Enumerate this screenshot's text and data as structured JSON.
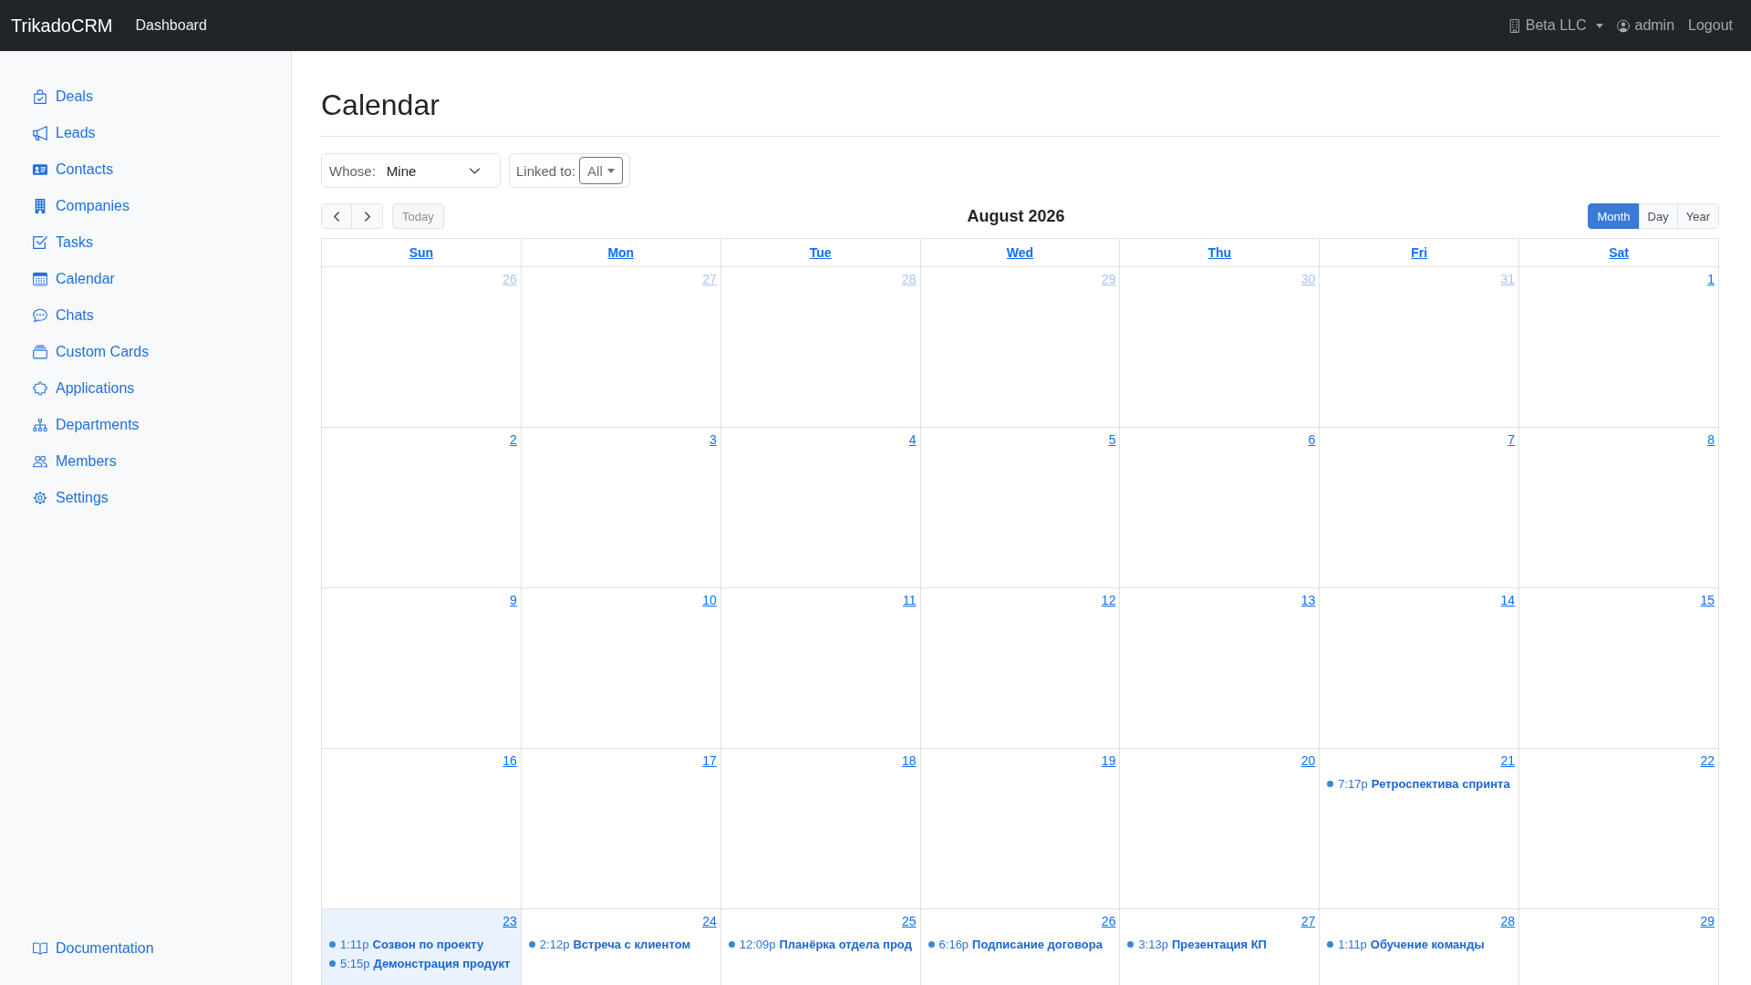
{
  "navbar": {
    "brand": "TrikadoCRM",
    "links": [
      {
        "label": "Dashboard"
      }
    ],
    "company": "Beta LLC",
    "user": "admin",
    "logout": "Logout"
  },
  "sidebar": {
    "items": [
      "Deals",
      "Leads",
      "Contacts",
      "Companies",
      "Tasks",
      "Calendar",
      "Chats",
      "Custom Cards",
      "Applications",
      "Departments",
      "Members",
      "Settings"
    ],
    "footer": [
      "Documentation"
    ]
  },
  "page": {
    "title": "Calendar"
  },
  "filters": {
    "whose": {
      "label": "Whose:",
      "value": "Mine"
    },
    "linked_to": {
      "label": "Linked to:",
      "value": "All"
    }
  },
  "calendar": {
    "title": "August 2026",
    "today_button": {
      "label": "Today",
      "disabled": true
    },
    "views": [
      {
        "label": "Month",
        "selected": true
      },
      {
        "label": "Day",
        "selected": false
      },
      {
        "label": "Year",
        "selected": false
      }
    ],
    "weekdays": [
      "Sun",
      "Mon",
      "Tue",
      "Wed",
      "Thu",
      "Fri",
      "Sat"
    ],
    "weeks": [
      [
        {
          "day": "26",
          "other_month": true,
          "today": false
        },
        {
          "day": "27",
          "other_month": true,
          "today": false
        },
        {
          "day": "28",
          "other_month": true,
          "today": false
        },
        {
          "day": "29",
          "other_month": true,
          "today": false
        },
        {
          "day": "30",
          "other_month": true,
          "today": false
        },
        {
          "day": "31",
          "other_month": true,
          "today": false
        },
        {
          "day": "1",
          "other_month": false,
          "today": false
        }
      ],
      [
        {
          "day": "2",
          "other_month": false,
          "today": false
        },
        {
          "day": "3",
          "other_month": false,
          "today": false
        },
        {
          "day": "4",
          "other_month": false,
          "today": false
        },
        {
          "day": "5",
          "other_month": false,
          "today": false
        },
        {
          "day": "6",
          "other_month": false,
          "today": false
        },
        {
          "day": "7",
          "other_month": false,
          "today": false
        },
        {
          "day": "8",
          "other_month": false,
          "today": false
        }
      ],
      [
        {
          "day": "9",
          "other_month": false,
          "today": false
        },
        {
          "day": "10",
          "other_month": false,
          "today": false
        },
        {
          "day": "11",
          "other_month": false,
          "today": false
        },
        {
          "day": "12",
          "other_month": false,
          "today": false
        },
        {
          "day": "13",
          "other_month": false,
          "today": false
        },
        {
          "day": "14",
          "other_month": false,
          "today": false
        },
        {
          "day": "15",
          "other_month": false,
          "today": false
        }
      ],
      [
        {
          "day": "16",
          "other_month": false,
          "today": false
        },
        {
          "day": "17",
          "other_month": false,
          "today": false
        },
        {
          "day": "18",
          "other_month": false,
          "today": false
        },
        {
          "day": "19",
          "other_month": false,
          "today": false
        },
        {
          "day": "20",
          "other_month": false,
          "today": false
        },
        {
          "day": "21",
          "other_month": false,
          "today": false,
          "events": [
            {
              "time": "7:17p",
              "title": "Ретроспектива спринта"
            }
          ]
        },
        {
          "day": "22",
          "other_month": false,
          "today": false
        }
      ],
      [
        {
          "day": "23",
          "other_month": false,
          "today": true,
          "events": [
            {
              "time": "1:11p",
              "title": "Созвон по проекту"
            },
            {
              "time": "5:15p",
              "title": "Демонстрация продукт"
            }
          ]
        },
        {
          "day": "24",
          "other_month": false,
          "today": false,
          "events": [
            {
              "time": "2:12p",
              "title": "Встреча с клиентом"
            }
          ]
        },
        {
          "day": "25",
          "other_month": false,
          "today": false,
          "events": [
            {
              "time": "12:09p",
              "title": "Планёрка отдела прод"
            }
          ]
        },
        {
          "day": "26",
          "other_month": false,
          "today": false,
          "events": [
            {
              "time": "6:16p",
              "title": "Подписание договора"
            }
          ]
        },
        {
          "day": "27",
          "other_month": false,
          "today": false,
          "events": [
            {
              "time": "3:13p",
              "title": "Презентация КП"
            }
          ]
        },
        {
          "day": "28",
          "other_month": false,
          "today": false,
          "events": [
            {
              "time": "1:11p",
              "title": "Обучение команды"
            }
          ]
        },
        {
          "day": "29",
          "other_month": false,
          "today": false
        }
      ]
    ]
  }
}
